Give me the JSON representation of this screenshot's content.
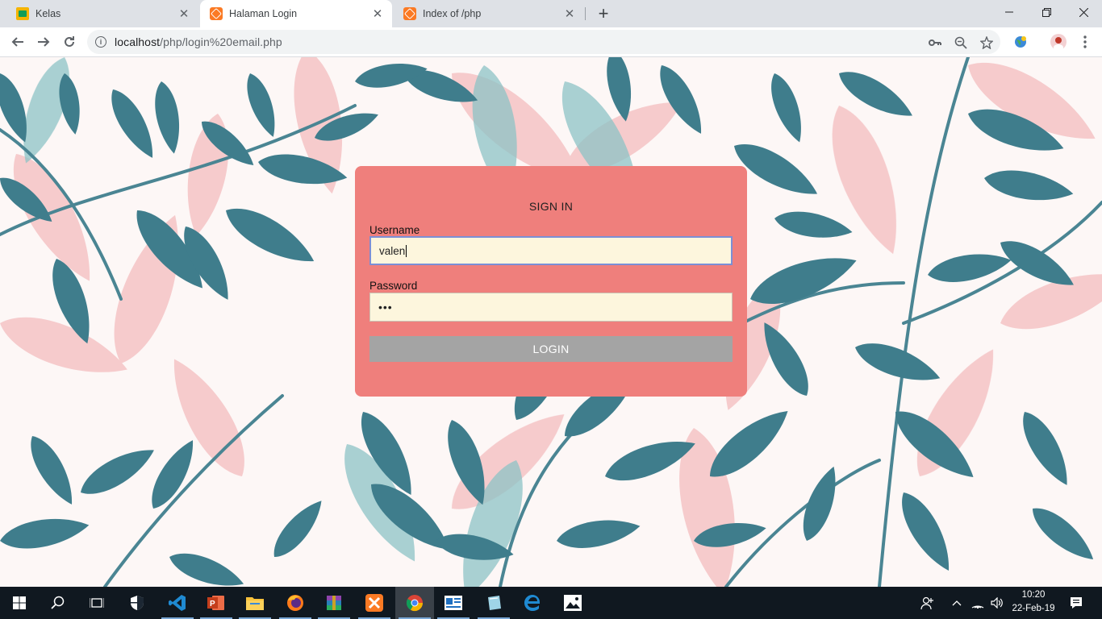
{
  "browser": {
    "tabs": [
      {
        "title": "Kelas",
        "icon": "classroom-icon",
        "active": false
      },
      {
        "title": "Halaman Login",
        "icon": "xampp-icon",
        "active": true
      },
      {
        "title": "Index of /php",
        "icon": "xampp-icon",
        "active": false
      }
    ],
    "url_host": "localhost",
    "url_path": "/php/login%20email.php"
  },
  "login": {
    "title": "SIGN IN",
    "username_label": "Username",
    "username_value": "valen",
    "password_label": "Password",
    "password_value": "•••",
    "button_label": "LOGIN"
  },
  "taskbar": {
    "apps": [
      "start-icon",
      "search-icon",
      "task-view-icon",
      "defender-icon",
      "vscode-icon",
      "powerpoint-icon",
      "file-explorer-icon",
      "firefox-icon",
      "winrar-icon",
      "xampp-icon",
      "chrome-icon",
      "news-icon",
      "notes-icon",
      "edge-icon",
      "photos-icon"
    ],
    "time": "10:20",
    "date": "22-Feb-19"
  },
  "colors": {
    "card": "#ef7f7c",
    "input_bg": "#fdf6dd",
    "button": "#a4a4a4",
    "leaf_teal": "#3f7d8c",
    "leaf_pink": "#f2b8bb"
  }
}
